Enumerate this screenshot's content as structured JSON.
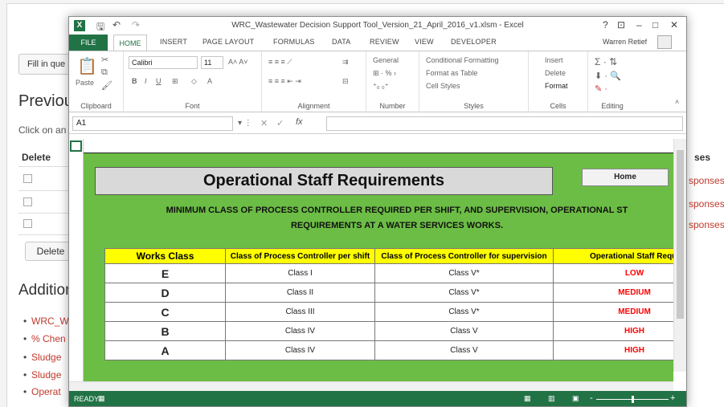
{
  "bg": {
    "fill_btn": "Fill in que",
    "previous_heading": "Previous",
    "click_text": "Click on an",
    "delete_col": "Delete",
    "delete_btn": "Delete",
    "additional_heading": "Addition",
    "links": [
      "WRC_W",
      "% Chen",
      "Sludge",
      "Sludge",
      "Operat"
    ],
    "right_col_header": "ses",
    "responses": [
      "sponses",
      "sponses",
      "sponses"
    ]
  },
  "excel": {
    "title": "WRC_Wastewater Decision Support Tool_Version_21_April_2016_v1.xlsm - Excel",
    "tabs": [
      "FILE",
      "HOME",
      "INSERT",
      "PAGE LAYOUT",
      "FORMULAS",
      "DATA",
      "REVIEW",
      "VIEW",
      "DEVELOPER"
    ],
    "user": "Warren Retief",
    "window_controls": [
      "?",
      "⊡",
      "–",
      "□",
      "✕"
    ],
    "ribbon": {
      "paste": "Paste",
      "font_name": "Calibri",
      "font_size": "11",
      "number_format": "General",
      "cond_format": "Conditional Formatting",
      "format_table": "Format as Table",
      "cell_styles": "Cell Styles",
      "insert": "Insert",
      "delete": "Delete",
      "format": "Format",
      "groups": [
        "Clipboard",
        "Font",
        "Alignment",
        "Number",
        "Styles",
        "Cells",
        "Editing"
      ]
    },
    "name_box": "A1",
    "status": "READY"
  },
  "sheet": {
    "title": "Operational Staff Requirements",
    "home_button": "Home",
    "subtitle_line1": "MINIMUM CLASS OF PROCESS CONTROLLER REQUIRED PER SHIFT, AND SUPERVISION, OPERATIONAL ST",
    "subtitle_line2": "REQUIREMENTS AT A WATER SERVICES WORKS.",
    "headers": [
      "Works Class",
      "Class of Process Controller per shift",
      "Class of Process Controller for supervision",
      "Operational Staff Requi"
    ],
    "rows": [
      {
        "works": "E",
        "shift": "Class I",
        "supervision": "Class V*",
        "level": "LOW"
      },
      {
        "works": "D",
        "shift": "Class II",
        "supervision": "Class V*",
        "level": "MEDIUM"
      },
      {
        "works": "C",
        "shift": "Class III",
        "supervision": "Class V*",
        "level": "MEDIUM"
      },
      {
        "works": "B",
        "shift": "Class IV",
        "supervision": "Class V",
        "level": "HIGH"
      },
      {
        "works": "A",
        "shift": "Class IV",
        "supervision": "Class V",
        "level": "HIGH"
      }
    ]
  },
  "colors": {
    "excel_green": "#217346",
    "sheet_green": "#6cbd45",
    "header_yellow": "#ffff00",
    "level_red": "#ff0000",
    "link_red": "#c0392b"
  }
}
